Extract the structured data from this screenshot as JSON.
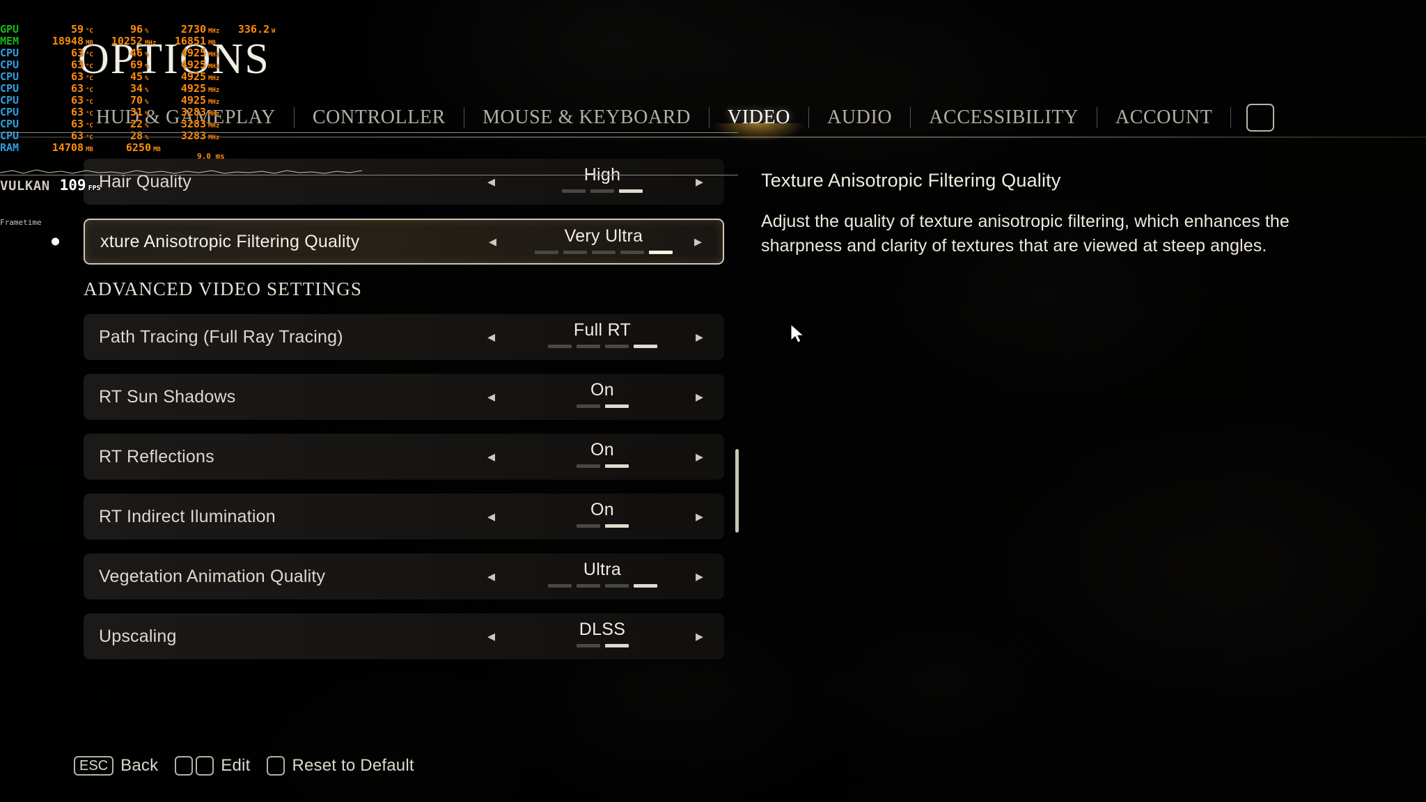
{
  "screen": {
    "title": "OPTIONS"
  },
  "perf_overlay": {
    "rows": [
      {
        "label": "GPU",
        "sub": "2",
        "color": "gpu",
        "cells": [
          {
            "value": "59",
            "unit": "°C",
            "w": "w-temp"
          },
          {
            "value": "96",
            "unit": "%",
            "w": "w-pct"
          },
          {
            "value": "2730",
            "unit": "MHz",
            "w": "w-clk"
          },
          {
            "value": "336.2",
            "unit": "W",
            "w": "w-pwr"
          }
        ]
      },
      {
        "label": "MEM",
        "sub": "2",
        "color": "gpu",
        "cells": [
          {
            "value": "18948",
            "unit": "MB",
            "w": "w-temp"
          },
          {
            "value": "10252",
            "unit": "MHz",
            "w": "w-pct"
          },
          {
            "value": "16851",
            "unit": "MB",
            "w": "w-clk"
          }
        ]
      },
      {
        "label": "CPU",
        "sub": "1",
        "color": "cpu",
        "cells": [
          {
            "value": "63",
            "unit": "°C",
            "w": "w-temp"
          },
          {
            "value": "46",
            "unit": "%",
            "w": "w-pct"
          },
          {
            "value": "4925",
            "unit": "MHz",
            "w": "w-clk"
          }
        ]
      },
      {
        "label": "CPU",
        "sub": "2",
        "color": "cpu",
        "cells": [
          {
            "value": "63",
            "unit": "°C",
            "w": "w-temp"
          },
          {
            "value": "69",
            "unit": "%",
            "w": "w-pct"
          },
          {
            "value": "4925",
            "unit": "MHz",
            "w": "w-clk"
          }
        ]
      },
      {
        "label": "CPU",
        "sub": "3",
        "color": "cpu",
        "cells": [
          {
            "value": "63",
            "unit": "°C",
            "w": "w-temp"
          },
          {
            "value": "45",
            "unit": "%",
            "w": "w-pct"
          },
          {
            "value": "4925",
            "unit": "MHz",
            "w": "w-clk"
          }
        ]
      },
      {
        "label": "CPU",
        "sub": "4",
        "color": "cpu",
        "cells": [
          {
            "value": "63",
            "unit": "°C",
            "w": "w-temp"
          },
          {
            "value": "34",
            "unit": "%",
            "w": "w-pct"
          },
          {
            "value": "4925",
            "unit": "MHz",
            "w": "w-clk"
          }
        ]
      },
      {
        "label": "CPU",
        "sub": "5",
        "color": "cpu",
        "cells": [
          {
            "value": "63",
            "unit": "°C",
            "w": "w-temp"
          },
          {
            "value": "70",
            "unit": "%",
            "w": "w-pct"
          },
          {
            "value": "4925",
            "unit": "MHz",
            "w": "w-clk"
          }
        ]
      },
      {
        "label": "CPU",
        "sub": "6",
        "color": "cpu",
        "cells": [
          {
            "value": "63",
            "unit": "°C",
            "w": "w-temp"
          },
          {
            "value": "31",
            "unit": "%",
            "w": "w-pct"
          },
          {
            "value": "3283",
            "unit": "MHz",
            "w": "w-clk"
          }
        ]
      },
      {
        "label": "CPU",
        "sub": "7",
        "color": "cpu",
        "cells": [
          {
            "value": "63",
            "unit": "°C",
            "w": "w-temp"
          },
          {
            "value": "22",
            "unit": "%",
            "w": "w-pct"
          },
          {
            "value": "3283",
            "unit": "MHz",
            "w": "w-clk"
          }
        ]
      },
      {
        "label": "CPU",
        "sub": "8",
        "color": "cpu",
        "cells": [
          {
            "value": "63",
            "unit": "°C",
            "w": "w-temp"
          },
          {
            "value": "28",
            "unit": "%",
            "w": "w-pct"
          },
          {
            "value": "3283",
            "unit": "MHz",
            "w": "w-clk"
          }
        ]
      },
      {
        "label": "RAM",
        "sub": "",
        "color": "cpu",
        "cells": [
          {
            "value": "14708",
            "unit": "MB",
            "w": "w-temp"
          },
          {
            "value": "6250",
            "unit": "MB",
            "w": "w-mem"
          }
        ]
      }
    ],
    "api": "VULKAN",
    "fps": "109",
    "fps_unit": "FPS",
    "frametime_label": "Frametime",
    "frametime_value": "9.0 ms"
  },
  "tabs": [
    {
      "label": "HUD & GAMEPLAY",
      "active": false
    },
    {
      "label": "CONTROLLER",
      "active": false
    },
    {
      "label": "MOUSE & KEYBOARD",
      "active": false
    },
    {
      "label": "VIDEO",
      "active": true
    },
    {
      "label": "AUDIO",
      "active": false
    },
    {
      "label": "ACCESSIBILITY",
      "active": false
    },
    {
      "label": "ACCOUNT",
      "active": false
    }
  ],
  "settings": {
    "section_header": "ADVANCED VIDEO SETTINGS",
    "top_rows": [
      {
        "label": "Hair Quality",
        "value": "High",
        "segments_total": 3,
        "segments_on": 3,
        "selected": false
      },
      {
        "label": "Texture Anisotropic Filtering Quality",
        "display_label": "xture Anisotropic Filtering Quality",
        "value": "Very Ultra",
        "segments_total": 5,
        "segments_on": 5,
        "selected": true
      }
    ],
    "advanced_rows": [
      {
        "label": "Path Tracing (Full Ray Tracing)",
        "value": "Full RT",
        "segments_total": 4,
        "segments_on": 4,
        "selected": false
      },
      {
        "label": "RT Sun Shadows",
        "value": "On",
        "segments_total": 2,
        "segments_on": 2,
        "selected": false
      },
      {
        "label": "RT Reflections",
        "value": "On",
        "segments_total": 2,
        "segments_on": 2,
        "selected": false
      },
      {
        "label": "RT Indirect Ilumination",
        "value": "On",
        "segments_total": 2,
        "segments_on": 2,
        "selected": false
      },
      {
        "label": "Vegetation Animation Quality",
        "value": "Ultra",
        "segments_total": 4,
        "segments_on": 4,
        "selected": false
      },
      {
        "label": "Upscaling",
        "value": "DLSS",
        "segments_total": 2,
        "segments_on": 2,
        "selected": false
      }
    ],
    "arrow_left": "◂",
    "arrow_right": "▸"
  },
  "description": {
    "title": "Texture Anisotropic Filtering Quality",
    "body": "Adjust the quality of texture anisotropic filtering, which enhances the sharpness and clarity of textures that are viewed at steep angles."
  },
  "footer_hints": [
    {
      "keys": [
        "ESC"
      ],
      "label": "Back"
    },
    {
      "keys": [
        "",
        ""
      ],
      "label": "Edit"
    },
    {
      "keys": [
        ""
      ],
      "label": "Reset to Default"
    }
  ],
  "colors": {
    "accent": "#ffba3c",
    "text": "#ece8dc",
    "row_bg": "#1d1b19",
    "overlay_value": "#ff8c0a",
    "overlay_gpu": "#16b816",
    "overlay_cpu": "#2f9fe0"
  }
}
